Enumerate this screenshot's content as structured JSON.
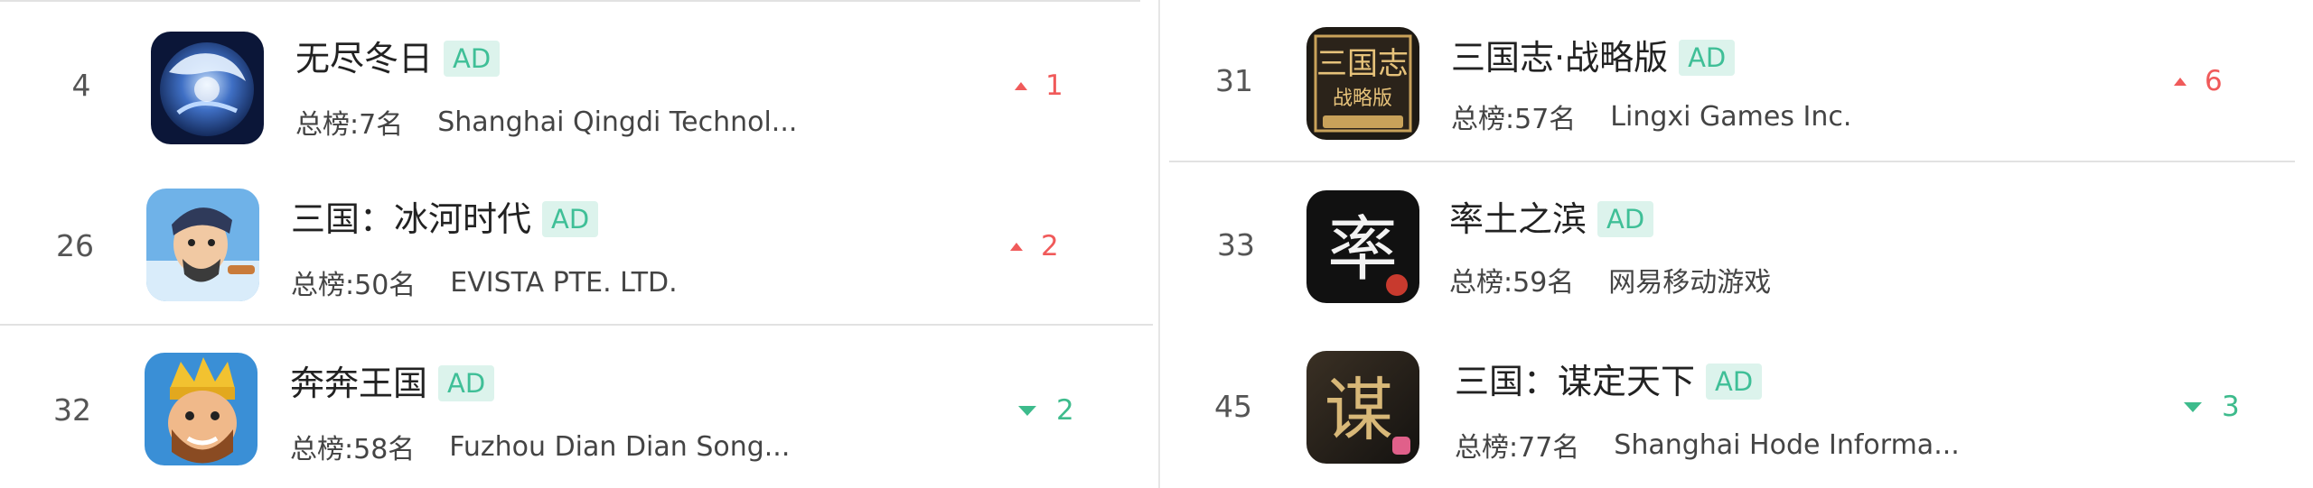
{
  "left_list": [
    {
      "rank": "4",
      "name": "无尽冬日",
      "badge": "AD",
      "overall": "总榜:7名",
      "developer": "Shanghai Qingdi Technol...",
      "trend": "up",
      "change": "1",
      "icon": "frost-orb-icon"
    },
    {
      "rank": "26",
      "name": "三国：冰河时代",
      "badge": "AD",
      "overall": "总榜:50名",
      "developer": "EVISTA PTE. LTD.",
      "trend": "up",
      "change": "2",
      "icon": "warrior-portrait-icon"
    },
    {
      "rank": "32",
      "name": "奔奔王国",
      "badge": "AD",
      "overall": "总榜:58名",
      "developer": "Fuzhou Dian Dian Song...",
      "trend": "down",
      "change": "2",
      "icon": "king-portrait-icon"
    }
  ],
  "right_list": [
    {
      "rank": "31",
      "name": "三国志·战略版",
      "badge": "AD",
      "overall": "总榜:57名",
      "developer": "Lingxi Games Inc.",
      "trend": "up",
      "change": "6",
      "icon": "sanguozhi-logo-icon"
    },
    {
      "rank": "33",
      "name": "率土之滨",
      "badge": "AD",
      "overall": "总榜:59名",
      "developer": "网易移动游戏",
      "trend": "none",
      "change": "",
      "icon": "calligraphy-shuai-icon"
    },
    {
      "rank": "45",
      "name": "三国：谋定天下",
      "badge": "AD",
      "overall": "总榜:77名",
      "developer": "Shanghai Hode Informa...",
      "trend": "down",
      "change": "3",
      "icon": "calligraphy-mou-icon"
    }
  ],
  "colors": {
    "up": "#f05a5a",
    "down": "#3dbb8c",
    "ad_bg": "#dcf3ec",
    "ad_text": "#3fbf97"
  }
}
